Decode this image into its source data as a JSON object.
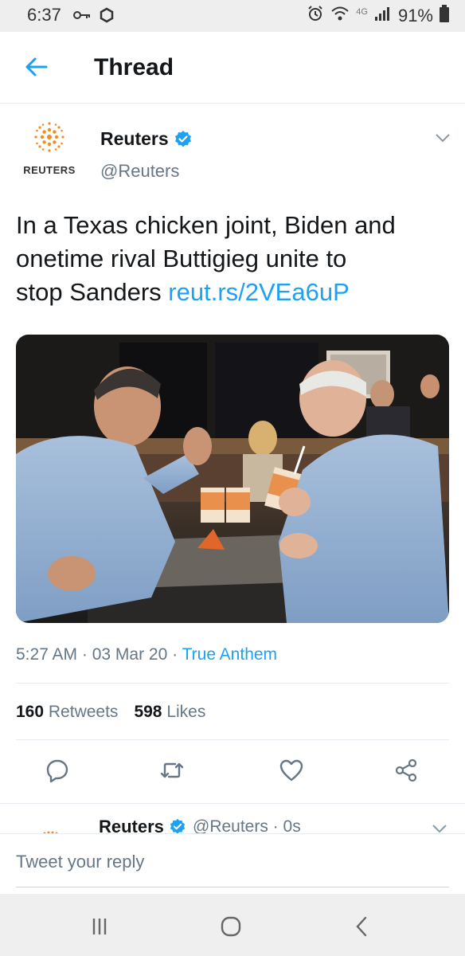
{
  "status_bar": {
    "time": "6:37",
    "network": "4G",
    "battery": "91%",
    "icons": [
      "key-icon",
      "sync-icon",
      "alarm-icon",
      "wifi-icon",
      "signal-icon",
      "battery-icon"
    ]
  },
  "app_bar": {
    "title": "Thread",
    "back_icon": "arrow-left-icon"
  },
  "tweet": {
    "author_name": "Reuters",
    "author_handle": "@Reuters",
    "avatar_text": "REUTERS",
    "text_line1": "In a Texas chicken joint, Biden and",
    "text_line2": "onetime rival Buttigieg unite to",
    "text_line3_prefix": "stop Sanders ",
    "link": "reut.rs/2VEa6uP",
    "time": "5:27 AM",
    "date": "03 Mar 20",
    "source": "True Anthem",
    "retweets_count": "160",
    "retweets_label": "Retweets",
    "likes_count": "598",
    "likes_label": "Likes"
  },
  "actions": [
    "reply-icon",
    "retweet-icon",
    "like-icon",
    "share-icon"
  ],
  "next_tweet": {
    "author_name": "Reuters",
    "handle_time": "@Reuters · 0s"
  },
  "reply": {
    "placeholder": "Tweet your reply"
  },
  "colors": {
    "accent": "#1da1f2",
    "text": "#14171a",
    "secondary": "#657786",
    "reuters_orange": "#f28c1e"
  }
}
